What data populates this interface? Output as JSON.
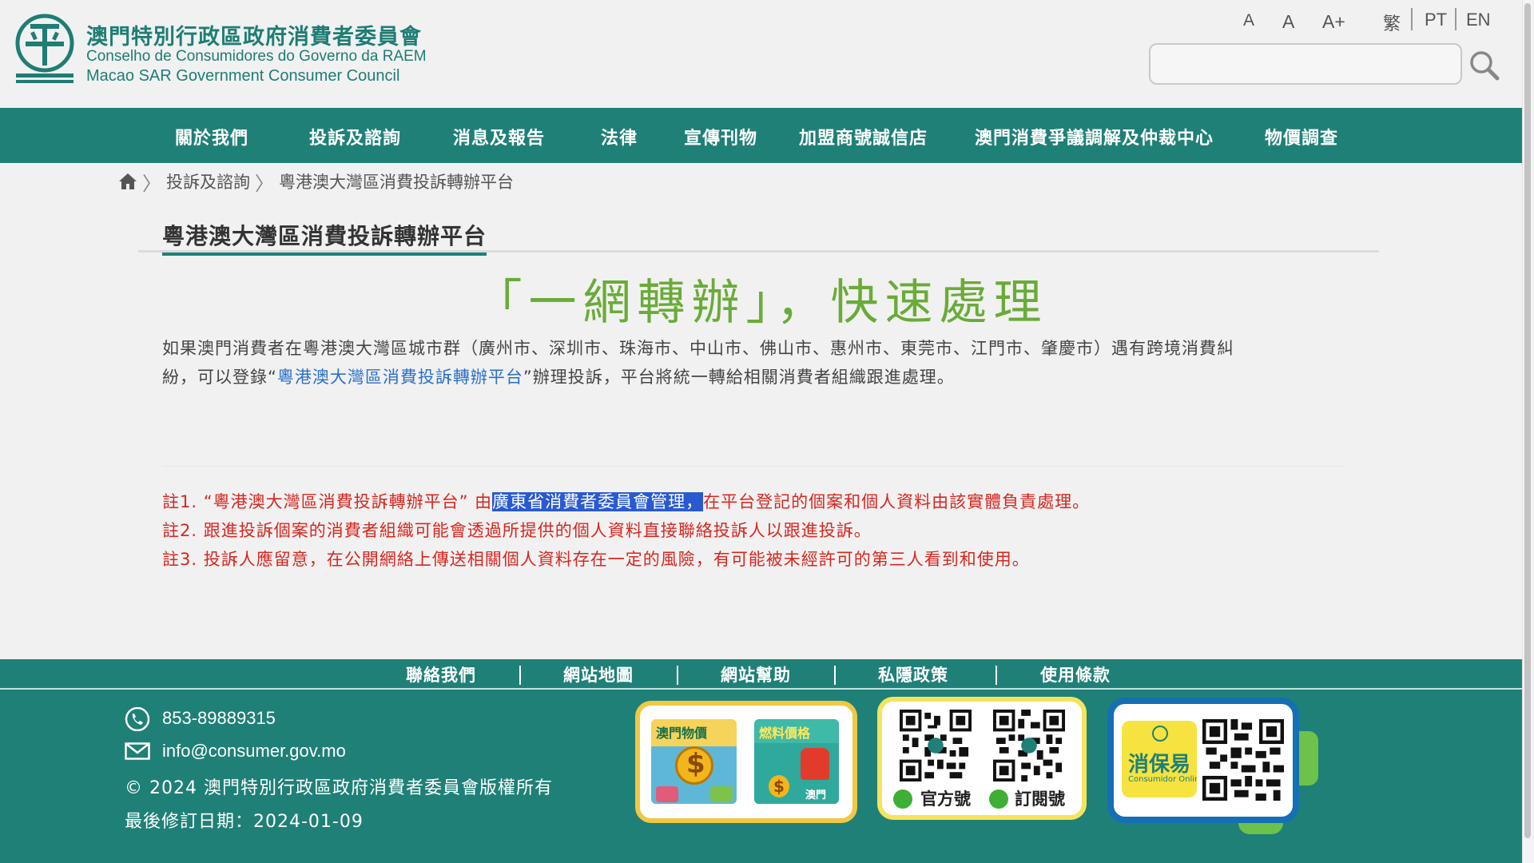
{
  "header": {
    "org_name_zh": "澳門特別行政區政府消費者委員會",
    "org_name_pt": "Conselho de Consumidores do Governo da RAEM",
    "org_name_en": "Macao SAR Government Consumer Council",
    "logo_char": "平",
    "font_small": "A",
    "font_medium": "A",
    "font_large": "A+",
    "lang_tc": "繁",
    "lang_pt": "PT",
    "lang_en": "EN",
    "search_placeholder": ""
  },
  "nav": {
    "items": [
      {
        "label": "關於我們"
      },
      {
        "label": "投訴及諮詢"
      },
      {
        "label": "消息及報告"
      },
      {
        "label": "法律"
      },
      {
        "label": "宣傳刊物"
      },
      {
        "label": "加盟商號誠信店"
      },
      {
        "label": "澳門消費爭議調解及仲裁中心"
      },
      {
        "label": "物價調查"
      }
    ]
  },
  "breadcrumb": {
    "items": [
      {
        "label": "投訴及諮詢"
      },
      {
        "label": "粵港澳大灣區消費投訴轉辦平台"
      }
    ]
  },
  "main": {
    "title": "粵港澳大灣區消費投訴轉辦平台",
    "slogan": "「一網轉辦」，快速處理",
    "intro_line1": "如果澳門消費者在粵港澳大灣區城市群（廣州市、深圳市、珠海市、中山市、佛山市、惠州市、東莞市、江門市、肇慶市）遇有跨境消費糾",
    "intro_line2_pre": "紛，可以登錄“",
    "intro_link": "粵港澳大灣區消費投訴轉辦平台",
    "intro_line2_post": "”辦理投訴，平台將統一轉給相關消費者組織跟進處理。",
    "notes": [
      {
        "pre": "註1. “粵港澳大灣區消費投訴轉辦平台” 由",
        "highlight": "廣東省消費者委員會管理，",
        "post": "在平台登記的個案和個人資料由該實體負責處理。"
      },
      {
        "pre": "註2. 跟進投訴個案的消費者組織可能會透過所提供的個人資料直接聯絡投訴人以跟進投訴。",
        "highlight": "",
        "post": ""
      },
      {
        "pre": "註3. 投訴人應留意，在公開網絡上傳送相關個人資料存在一定的風險，有可能被未經許可的第三人看到和使用。",
        "highlight": "",
        "post": ""
      }
    ]
  },
  "footer_links": {
    "items": [
      {
        "label": "聯絡我們"
      },
      {
        "label": "網站地圖"
      },
      {
        "label": "網站幫助"
      },
      {
        "label": "私隱政策"
      },
      {
        "label": "使用條款"
      }
    ]
  },
  "footer": {
    "phone": "853-89889315",
    "email": "info@consumer.gov.mo",
    "copyright": "© 2024 澳門特別行政區政府消費者委員會版權所有",
    "updated": "最後修訂日期：2024-01-09",
    "price_card": {
      "tile1_label": "澳門物價",
      "tile2_label": "燃料價格",
      "tile2_sub": "澳門"
    },
    "wechat_card": {
      "official_label": "官方號",
      "subscribe_label": "訂閱號"
    },
    "app_card": {
      "app_name": "消保易",
      "app_sub": "Consumidor Online"
    }
  },
  "colors": {
    "brand_teal": "#1f8077",
    "slogan_green": "#6aab38",
    "note_red": "#d8261f",
    "link_blue": "#2a6fc9"
  }
}
